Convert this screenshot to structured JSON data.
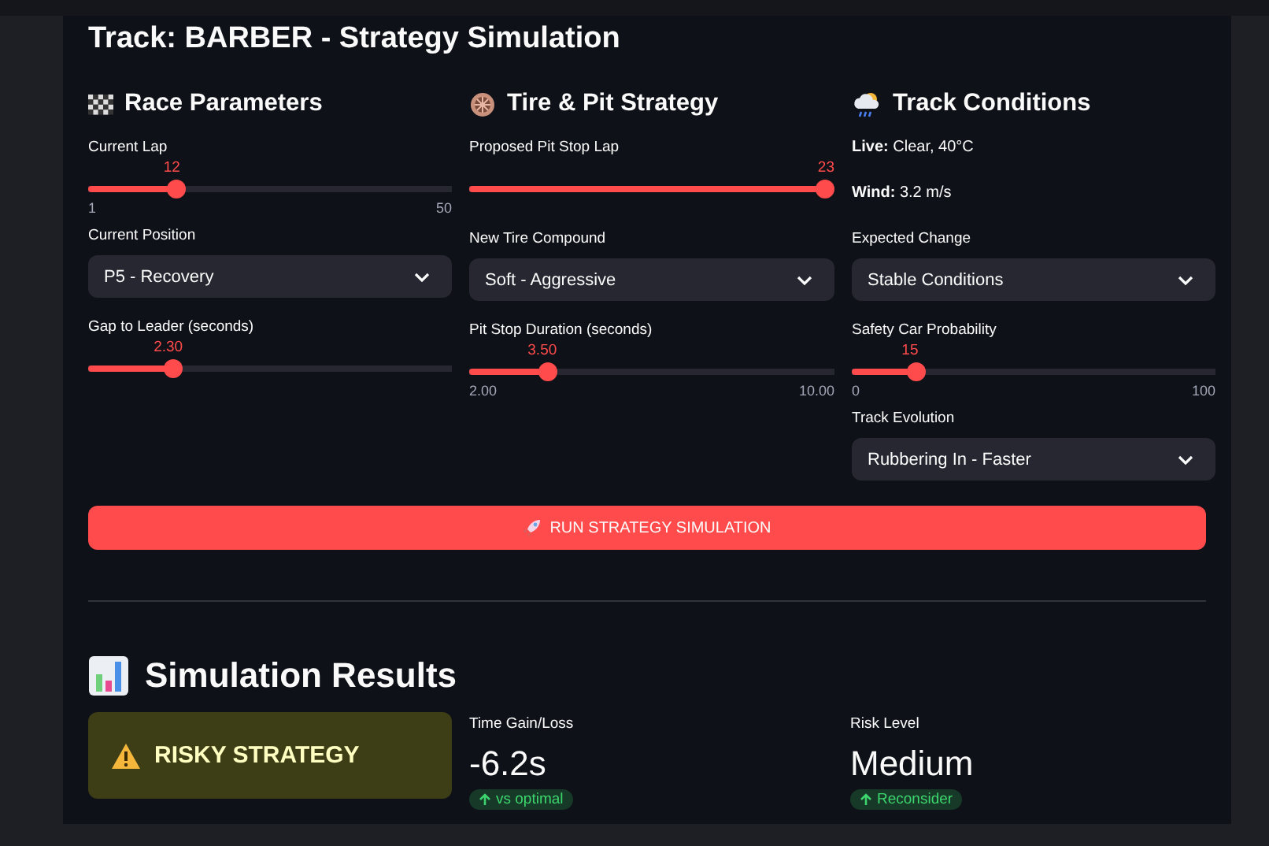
{
  "title": "Track: BARBER - Strategy Simulation",
  "columns": [
    {
      "heading": "Race Parameters",
      "widgets": [
        {
          "kind": "slider",
          "label": "Current Lap",
          "value": "12",
          "level": 0.23,
          "min": "1",
          "max": "50"
        },
        {
          "kind": "select",
          "label": "Current Position",
          "value": "P5 - Recovery"
        },
        {
          "kind": "slider",
          "label": "Gap to Leader (seconds)",
          "value": "2.30",
          "level": 0.22
        }
      ]
    },
    {
      "heading": "Tire & Pit Strategy",
      "widgets": [
        {
          "kind": "slider",
          "label": "Proposed Pit Stop Lap",
          "value": "23",
          "level": 1.0
        },
        {
          "kind": "select",
          "label": "New Tire Compound",
          "value": "Soft - Aggressive"
        },
        {
          "kind": "slider",
          "label": "Pit Stop Duration (seconds)",
          "value": "3.50",
          "level": 0.2,
          "min": "2.00",
          "max": "10.00"
        }
      ]
    },
    {
      "heading": "Track Conditions",
      "widgets": [
        {
          "kind": "info",
          "text": "**Live:** Clear, 40°C"
        },
        {
          "kind": "info",
          "text": "**Wind:** 3.2 m/s"
        },
        {
          "kind": "select",
          "label": "Expected Change",
          "value": "Stable Conditions"
        },
        {
          "kind": "slider",
          "label": "Safety Car Probability",
          "value": "15",
          "level": 0.16,
          "min": "0",
          "max": "100"
        },
        {
          "kind": "select",
          "label": "Track Evolution",
          "value": "Rubbering In - Faster"
        }
      ]
    }
  ],
  "run_button": "RUN STRATEGY SIMULATION",
  "results": {
    "heading": "Simulation Results",
    "verdict": "RISKY STRATEGY",
    "metrics": [
      {
        "label": "Time Gain/Loss",
        "value": "-6.2s",
        "delta": "vs optimal"
      },
      {
        "label": "Risk Level",
        "value": "Medium",
        "delta": "Reconsider"
      }
    ]
  }
}
